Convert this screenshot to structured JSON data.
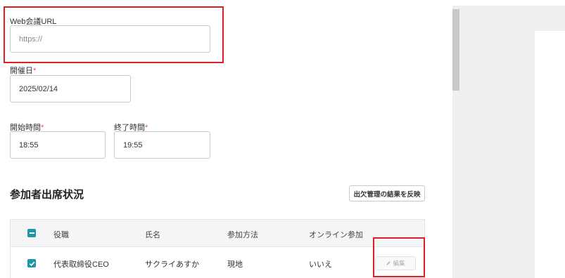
{
  "form": {
    "web_url": {
      "label": "Web会議URL",
      "placeholder": "https://"
    },
    "date": {
      "label": "開催日",
      "required_mark": "*",
      "value": "2025/02/14"
    },
    "start_time": {
      "label": "開始時間",
      "required_mark": "*",
      "value": "18:55"
    },
    "end_time": {
      "label": "終了時間",
      "required_mark": "*",
      "value": "19:55"
    }
  },
  "attendance": {
    "title": "参加者出席状況",
    "reflect_button": "出欠管理の結果を反映",
    "columns": [
      "役職",
      "氏名",
      "参加方法",
      "オンライン参加"
    ],
    "rows": [
      {
        "role": "代表取締役CEO",
        "name": "サクライあすか",
        "method": "現地",
        "online": "いいえ",
        "edit_label": "編集",
        "checked": true
      }
    ]
  },
  "colors": {
    "accent": "#1f95a8",
    "highlight": "#e02020",
    "required": "#e05252"
  }
}
